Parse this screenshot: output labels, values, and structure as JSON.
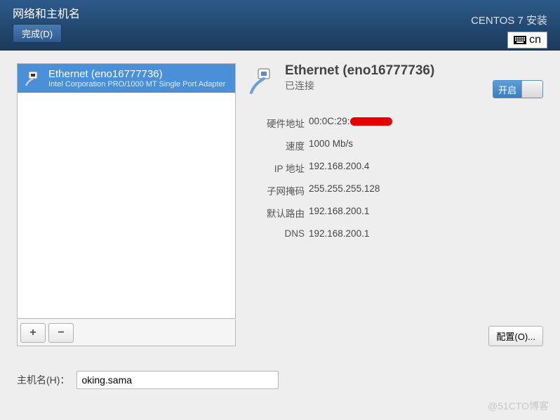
{
  "header": {
    "title": "网络和主机名",
    "done_button": "完成(D)",
    "installer_name": "CENTOS 7 安装",
    "keyboard_layout": "cn"
  },
  "devices": [
    {
      "name": "Ethernet (eno16777736)",
      "desc": "Intel Corporation PRO/1000 MT Single Port Adapter"
    }
  ],
  "buttons": {
    "add": "+",
    "remove": "−",
    "configure": "配置(O)...",
    "toggle_on": "开启"
  },
  "detail": {
    "title": "Ethernet (eno16777736)",
    "status": "已连接",
    "info": [
      {
        "label": "硬件地址",
        "value": "00:0C:29:",
        "redacted": true
      },
      {
        "label": "速度",
        "value": "1000 Mb/s"
      },
      {
        "label": "IP 地址",
        "value": "192.168.200.4"
      },
      {
        "label": "子网掩码",
        "value": "255.255.255.128"
      },
      {
        "label": "默认路由",
        "value": "192.168.200.1"
      },
      {
        "label": "DNS",
        "value": "192.168.200.1"
      }
    ]
  },
  "hostname": {
    "label": "主机名(H)：",
    "value": "oking.sama"
  },
  "watermark": "@51CTO博客"
}
